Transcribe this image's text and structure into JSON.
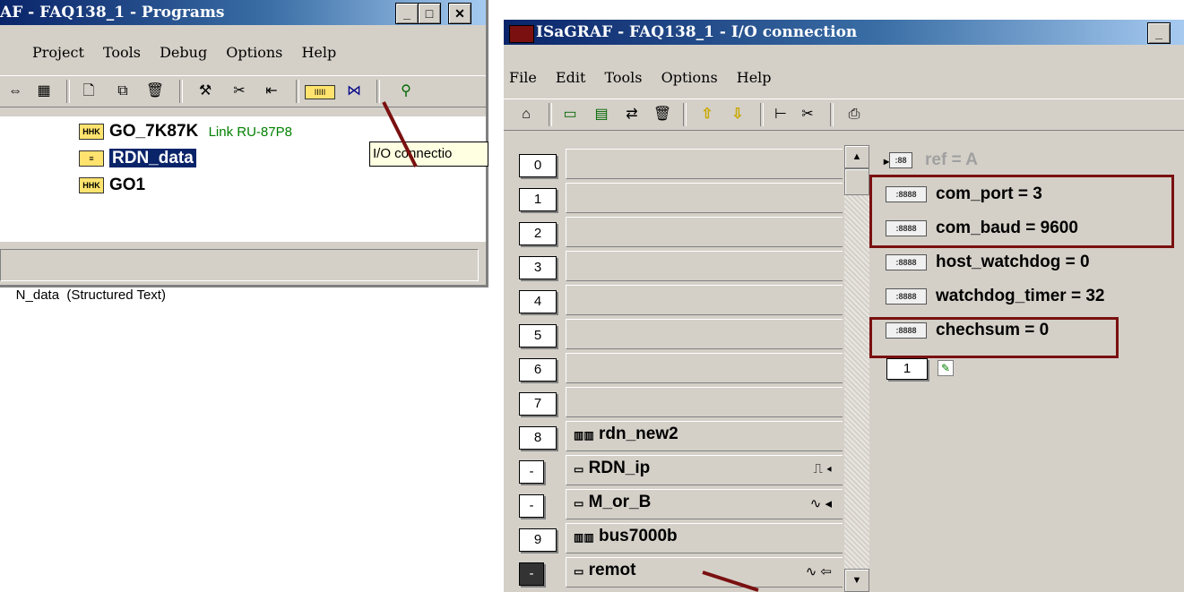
{
  "programs_window": {
    "title": "AF - FAQ138_1 - Programs",
    "menu": [
      "Project",
      "Tools",
      "Debug",
      "Options",
      "Help"
    ],
    "tree": [
      {
        "icon": "io-icon",
        "name": "GO_7K87K",
        "note": "Link RU-87P8"
      },
      {
        "icon": "structured-text-icon",
        "name": "RDN_data",
        "selected": true
      },
      {
        "icon": "io-icon",
        "name": "GO1"
      }
    ],
    "tooltip": "I/O connectio",
    "status": "N_data  (Structured Text)"
  },
  "io_window": {
    "title": "ISaGRAF - FAQ138_1 - I/O connection",
    "menu": [
      "File",
      "Edit",
      "Tools",
      "Options",
      "Help"
    ],
    "slots": [
      {
        "num": "0",
        "label": ""
      },
      {
        "num": "1",
        "label": ""
      },
      {
        "num": "2",
        "label": ""
      },
      {
        "num": "3",
        "label": ""
      },
      {
        "num": "4",
        "label": ""
      },
      {
        "num": "5",
        "label": ""
      },
      {
        "num": "6",
        "label": ""
      },
      {
        "num": "7",
        "label": ""
      },
      {
        "num": "8",
        "label": "rdn_new2"
      },
      {
        "num": "-",
        "label": "RDN_ip",
        "sub": true,
        "sym": "⎍ ◂"
      },
      {
        "num": "-",
        "label": "M_or_B",
        "sub": true,
        "sym": "∿ ◂"
      },
      {
        "num": "9",
        "label": "bus7000b"
      },
      {
        "num": "-",
        "label": "remot",
        "sub": true,
        "sym": "∿ ⇦",
        "dark": true
      }
    ],
    "params": [
      {
        "text": "ref = A",
        "dim": true
      },
      {
        "text": "com_port = 3"
      },
      {
        "text": "com_baud = 9600"
      },
      {
        "text": "host_watchdog = 0"
      },
      {
        "text": "watchdog_timer = 32"
      },
      {
        "text": "chechsum = 0"
      }
    ],
    "channel_num": "1"
  },
  "colors": {
    "highlight": "#7a1010",
    "note_green": "#008000",
    "selection": "#0a246a"
  }
}
